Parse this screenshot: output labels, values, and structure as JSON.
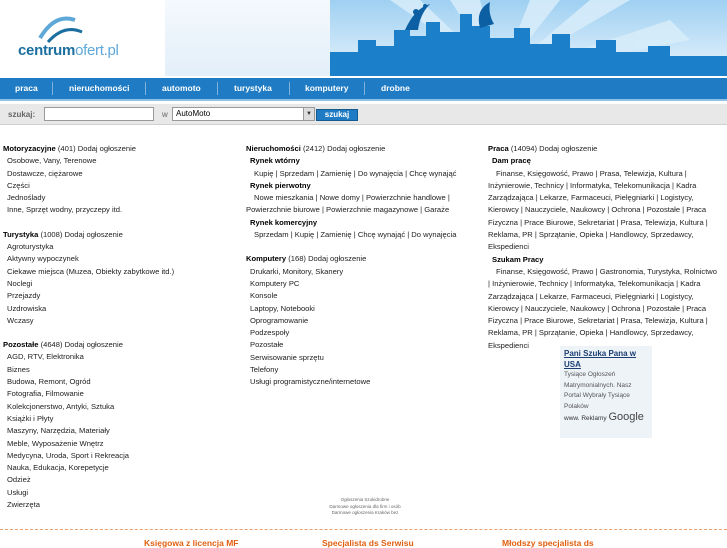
{
  "logo": {
    "bold": "centrum",
    "light": "ofert.pl"
  },
  "nav": [
    "praca",
    "nieruchomości",
    "automoto",
    "turystyka",
    "komputery",
    "drobne"
  ],
  "search": {
    "label": "szukaj:",
    "in_label": "w",
    "category_value": "AutoMoto",
    "button": "szukaj"
  },
  "col1": [
    {
      "title": "Motoryzacyjne",
      "count": "(401)",
      "add": "Dodaj ogłoszenie",
      "items": [
        "Osobowe, Vany, Terenowe",
        "Dostawcze, ciężarowe",
        "Części",
        "Jednoślady",
        "Inne, Sprzęt wodny, przyczepy itd."
      ]
    },
    {
      "title": "Turystyka",
      "count": "(1008)",
      "add": "Dodaj ogłoszenie",
      "items": [
        "Agroturystyka",
        "Aktywny wypoczynek",
        "Ciekawe miejsca (Muzea, Obiekty zabytkowe itd.)",
        "Noclegi",
        "Przejazdy",
        "Uzdrowiska",
        "Wczasy"
      ]
    },
    {
      "title": "Pozostałe",
      "count": "(4648)",
      "add": "Dodaj ogłoszenie",
      "items": [
        "AGD, RTV, Elektronika",
        "Biznes",
        "Budowa, Remont, Ogród",
        "Fotografia, Filmowanie",
        "Kolekcjonerstwo, Antyki, Sztuka",
        "Książki i Płyty",
        "Maszyny, Narzędzia, Materiały",
        "Meble, Wyposażenie Wnętrz",
        "Medycyna, Uroda, Sport i Rekreacja",
        "Nauka, Edukacja, Korepetycje",
        "Odzież",
        "Usługi",
        "Zwierzęta"
      ]
    }
  ],
  "col2": {
    "real_estate": {
      "title": "Nieruchomości",
      "count": "(2412)",
      "add": "Dodaj ogłoszenie",
      "groups": [
        {
          "name": "Rynek wtórny",
          "lines": [
            "Kupię | Sprzedam | Zamienię | Do wynajęcia | Chcę wynająć"
          ]
        },
        {
          "name": "Rynek pierwotny",
          "lines": [
            "Nowe mieszkania | Nowe domy | Powierzchnie handlowe |",
            "Powierzchnie biurowe | Powierzchnie magazynowe | Garaże"
          ]
        },
        {
          "name": "Rynek komercyjny",
          "lines": [
            "Sprzedam | Kupię | Zamienię | Chcę wynająć | Do wynajęcia"
          ]
        }
      ]
    },
    "computers": {
      "title": "Komputery",
      "count": "(168)",
      "add": "Dodaj ogłoszenie",
      "items": [
        "Drukarki, Monitory, Skanery",
        "Komputery PC",
        "Konsole",
        "Laptopy, Notebooki",
        "Oprogramowanie",
        "Podzespoły",
        "Pozostałe",
        "Serwisowanie sprzętu",
        "Telefony",
        "Usługi programistyczne/internetowe"
      ]
    }
  },
  "col3": {
    "title": "Praca",
    "count": "(14094)",
    "add": "Dodaj ogłoszenie",
    "groups": [
      {
        "name": "Dam pracę",
        "text": "Finanse, Księgowość, Prawo | Prasa, Telewizja, Kultura | Inżynierowie, Technicy | Informatyka, Telekomunikacja | Kadra Zarządzająca | Lekarze, Farmaceuci, Pielęgniarki | Logistycy, Kierowcy | Nauczyciele, Naukowcy | Ochrona | Pozostałe | Praca Fizyczna | Prace Biurowe, Sekretariat | Prasa, Telewizja, Kultura | Reklama, PR | Sprzątanie, Opieka | Handlowcy, Sprzedawcy, Ekspedienci"
      },
      {
        "name": "Szukam Pracy",
        "text": "Finanse, Księgowość, Prawo | Gastronomia, Turystyka, Rolnictwo | Inżynierowie, Technicy | Informatyka, Telekomunikacja | Kadra Zarządzająca | Lekarze, Farmaceuci, Pielęgniarki | Logistycy, Kierowcy | Nauczyciele, Naukowcy | Ochrona | Pozostałe | Praca Fizyczna | Prace Biurowe, Sekretariat | Prasa, Telewizja, Kultura | Reklama, PR | Sprzątanie, Opieka | Handlowcy, Sprzedawcy, Ekspedienci"
      }
    ]
  },
  "ad": {
    "title": "Pani Szuka Pana w USA",
    "desc": "Tysiące Ogłoszeń Matrymonialnych. Nasz Portal Wybrały Tysiące Polaków",
    "url": "www.",
    "reklamy": "Reklamy",
    "google": "Google"
  },
  "footer_lines": [
    "Ogłoszenia Szukidrobne",
    "Darmowe ogłoszenia dla firm i osób",
    "Darmowe ogłoszenia Kraków bez"
  ],
  "bottom_links": [
    "Księgowa z licencja MF",
    "Specjalista ds Serwisu",
    "Młodszy specjalista ds"
  ],
  "colors": {
    "nav_bg": "#1f7cc4",
    "accent_orange": "#e06010",
    "logo_blue": "#1a6ea0"
  }
}
